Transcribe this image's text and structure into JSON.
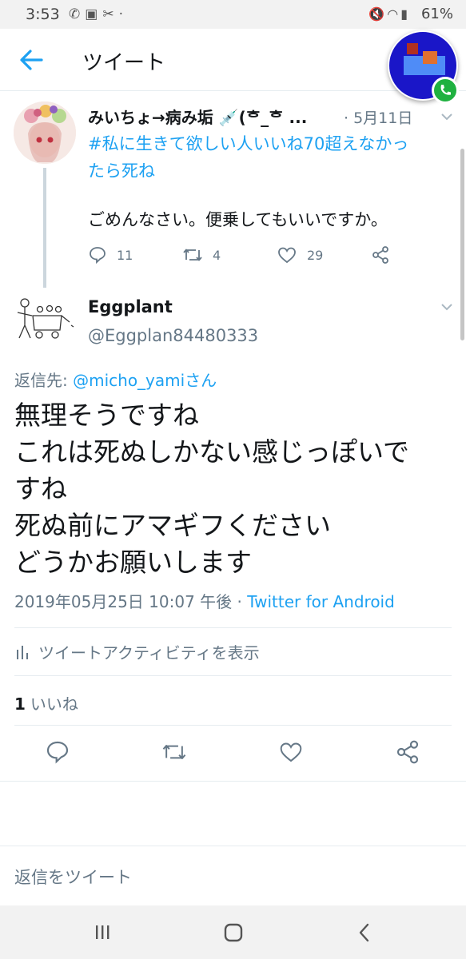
{
  "status_bar": {
    "time": "3:53",
    "left_icons": [
      "phone-forward-icon",
      "cube-icon",
      "tools-icon",
      "dot-icon"
    ],
    "right_icons": [
      "mute-icon",
      "wifi-icon",
      "signal-icon"
    ],
    "battery": "61%"
  },
  "header": {
    "title": "ツイート"
  },
  "parent_tweet": {
    "name": "みいちょ→病み垢 💉(ᄒ_ᄒ ...",
    "date": "· 5月11日",
    "hashtag_line1": "#私に生きて欲しい人いいね70超えなかっ",
    "hashtag_line2": "たら死ね",
    "body": "ごめんなさい。便乗してもいいですか。",
    "replies": "11",
    "retweets": "4",
    "likes": "29"
  },
  "tweet": {
    "name": "Eggplant",
    "handle": "@Eggplan84480333",
    "reply_prefix": "返信先: ",
    "reply_mention": "@micho_yamiさん",
    "text_lines": [
      "無理そうですね",
      "これは死ぬしかない感じっぽいで",
      "すね",
      "死ぬ前にアマギフください",
      "どうかお願いします"
    ],
    "timestamp": "2019年05月25日 10:07 午後 · ",
    "client": "Twitter for Android",
    "activity_label": "ツイートアクティビティを表示",
    "likes_count": "1",
    "likes_label": "いいね"
  },
  "reply_box": {
    "placeholder": "返信をツイート"
  },
  "colors": {
    "accent": "#1da1f2",
    "secondary_text": "#657786",
    "primary_text": "#14171a"
  }
}
